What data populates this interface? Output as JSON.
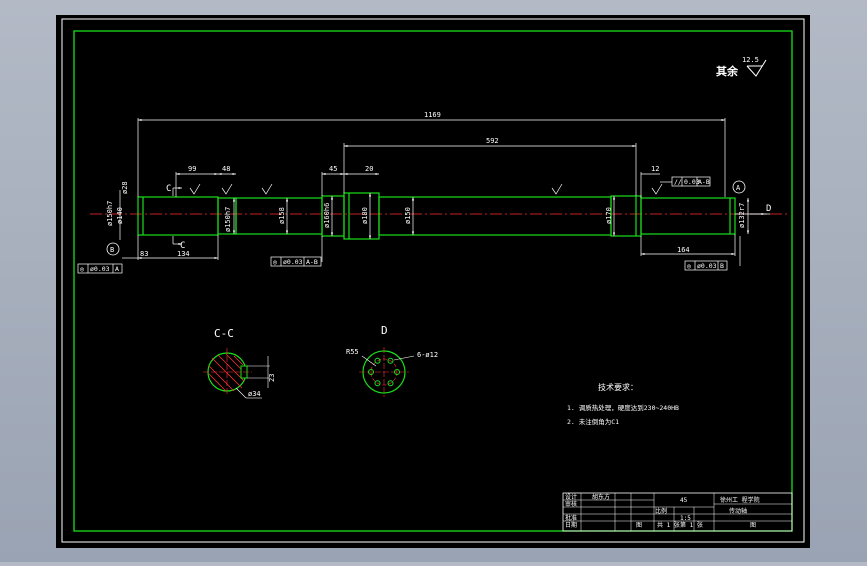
{
  "roughness": {
    "value": "12.5",
    "label": "其余"
  },
  "dimensions": {
    "overall_length": "1169",
    "span_592": "592",
    "d99": "99",
    "d48": "48",
    "d45": "45",
    "d20": "20",
    "d12": "12",
    "d83": "83",
    "d134": "134",
    "d164": "164",
    "phi_left_top": "ø28",
    "phi_150h7": "ø150h7",
    "phi_140": "ø140",
    "phi_150h7_b": "ø150h7",
    "phi_158": "ø158",
    "phi_160h6": "ø160h6",
    "phi_180": "ø180",
    "phi_150": "ø150",
    "phi_170": "ø170",
    "phi_132r7": "ø132r7"
  },
  "marks": {
    "section_c": "C",
    "section_c2": "C",
    "view_d": "D",
    "datum_a": "A",
    "datum_b": "B"
  },
  "tolerances": {
    "tl_left": {
      "sym": "◎",
      "val": "ø0.03",
      "ref": "A"
    },
    "tl_mid": {
      "sym": "◎",
      "val": "ø0.03",
      "ref": "A-B"
    },
    "tl_top": {
      "sym": "//",
      "val": "0.03",
      "ref": "A-B"
    },
    "tl_right": {
      "sym": "◎",
      "val": "ø0.03",
      "ref": "B"
    }
  },
  "section_cc": {
    "title": "C-C",
    "dim_phi": "ø34",
    "dim_side": "23"
  },
  "section_d": {
    "title": "D",
    "dim_r": "R55",
    "dim_holes": "6-ø12"
  },
  "notes": {
    "title": "技术要求：",
    "line1": "1. 调质热处理，硬度达到230~240HB",
    "line2": "2. 未注倒角为C1"
  },
  "title_block": {
    "material": "45",
    "school": "徐州工 程学院",
    "scale_label": "比例",
    "scale": "1:5",
    "part_name": "传动轴",
    "r1": "设计",
    "r1v": "胡东方",
    "r2": "审核",
    "r3": "批准",
    "r4": "日期",
    "sheet_a": "共 1 张",
    "sheet_b": "第 1 张",
    "drawing_no": "图",
    "bottom_mark": "图"
  }
}
